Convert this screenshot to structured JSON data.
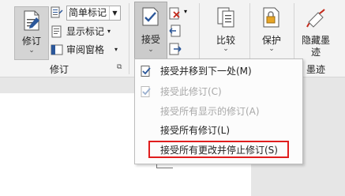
{
  "ribbon": {
    "track_changes": {
      "label": "修订"
    },
    "markup_select": {
      "value": "简单标记"
    },
    "show_markup": {
      "label": "显示标记"
    },
    "reviewing_pane": {
      "label": "审阅窗格"
    },
    "tracking_group_label": "修订",
    "accept": {
      "label": "接受"
    },
    "compare": {
      "label": "比较"
    },
    "protect": {
      "label": "保护"
    },
    "hide_ink": {
      "label_line1": "隐藏墨",
      "label_line2": "迹"
    },
    "ink_group_label": "墨迹"
  },
  "accept_menu": {
    "items": [
      {
        "label": "接受并移到下一处(M)",
        "enabled": true,
        "icon": "accept-check-icon"
      },
      {
        "label": "接受此修订(C)",
        "enabled": false,
        "icon": "accept-check-icon"
      },
      {
        "label": "接受所有显示的修订(A)",
        "enabled": false
      },
      {
        "label": "接受所有修订(L)",
        "enabled": true
      },
      {
        "label": "接受所有更改并停止修订(S)",
        "enabled": true,
        "highlighted": true
      }
    ]
  },
  "colors": {
    "highlight_box": "#e01d1d",
    "accent": "#2b579a"
  }
}
